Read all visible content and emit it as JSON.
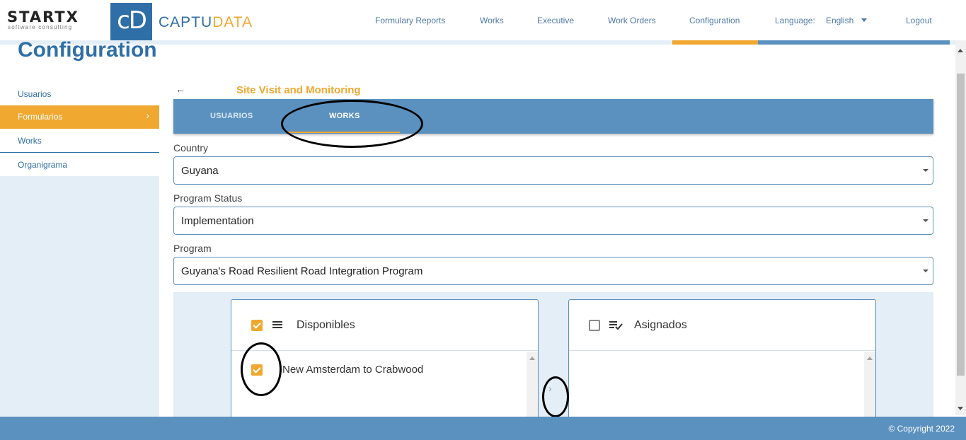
{
  "header": {
    "logo_left": "STARTX",
    "logo_left_sub": "software consulting",
    "logo_box": "cD",
    "logo_right_part1": "CAPTU",
    "logo_right_part2": "DATA",
    "nav": {
      "formulary_reports": "Formulary Reports",
      "works": "Works",
      "executive": "Executive",
      "work_orders": "Work Orders",
      "configuration": "Configuration",
      "language_label": "Language:",
      "language_value": "English",
      "logout": "Logout"
    }
  },
  "page_title": "Configuration",
  "sidebar": {
    "items": [
      {
        "label": "Usuarios"
      },
      {
        "label": "Formularios",
        "chevron": "›"
      },
      {
        "label": "Works"
      },
      {
        "label": "Organigrama"
      }
    ]
  },
  "section": {
    "back_icon": "←",
    "title": "Site Visit and Monitoring"
  },
  "tabs": {
    "usuarios": "USUARIOS",
    "works": "WORKS",
    "active": "WORKS"
  },
  "fields": {
    "country_label": "Country",
    "country_value": "Guyana",
    "status_label": "Program Status",
    "status_value": "Implementation",
    "program_label": "Program",
    "program_value": "Guyana's Road Resilient Road Integration Program"
  },
  "transfer": {
    "available_title": "Disponibles",
    "assigned_title": "Asignados",
    "available_items": [
      "New Amsterdam to Crabwood"
    ],
    "move_right_icon": "›"
  },
  "footer": {
    "copyright": "© Copyright 2022"
  },
  "colors": {
    "primary": "#2f6fa8",
    "accent": "#f0a830",
    "bar": "#5b91bf"
  }
}
